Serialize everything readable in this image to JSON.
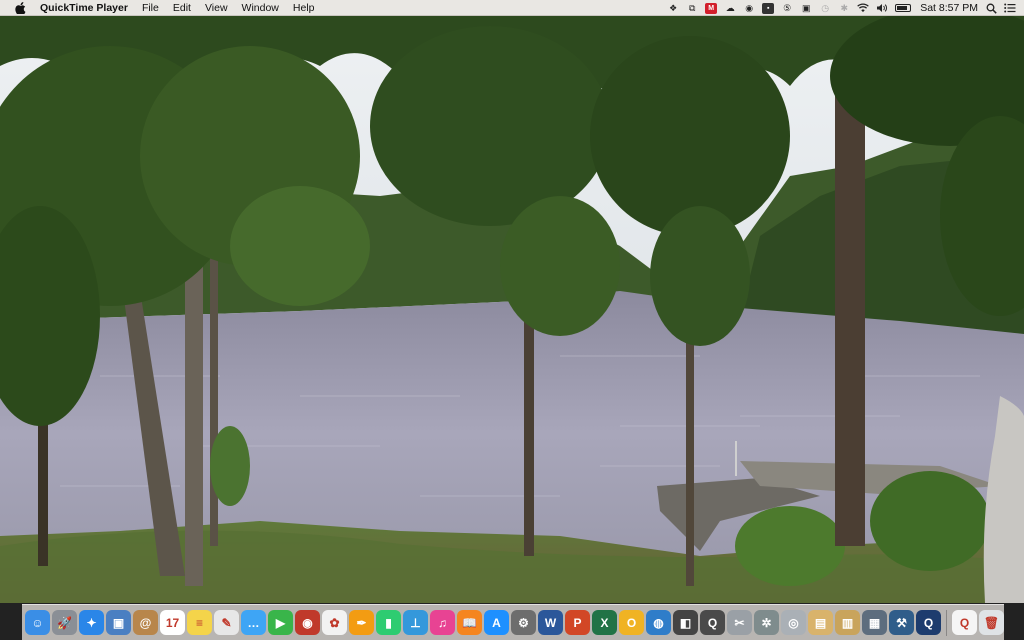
{
  "menubar": {
    "app_name": "QuickTime Player",
    "menus": [
      "File",
      "Edit",
      "View",
      "Window",
      "Help"
    ],
    "clock": "Sat 8:57 PM",
    "battery_level": 0.85,
    "status_icons": [
      "dropbox-icon",
      "copy-icon",
      "mail-m-icon",
      "creative-cloud-icon",
      "eye-icon",
      "terminal-icon",
      "five-icon",
      "camera-icon",
      "time-machine-icon",
      "bluetooth-icon",
      "wifi-icon",
      "volume-icon",
      "battery-icon",
      "spotlight-icon",
      "notification-center-icon"
    ]
  },
  "dock": {
    "apps": [
      {
        "name": "finder-icon",
        "color": "#3a8ee6",
        "glyph": "☺"
      },
      {
        "name": "launchpad-icon",
        "color": "#8a8f96",
        "glyph": "🚀"
      },
      {
        "name": "safari-icon",
        "color": "#2a86e8",
        "glyph": "✦"
      },
      {
        "name": "preview-icon",
        "color": "#4a7fc2",
        "glyph": "▣"
      },
      {
        "name": "contacts-icon",
        "color": "#b8864b",
        "glyph": "@"
      },
      {
        "name": "calendar-icon",
        "color": "#ffffff",
        "glyph": "17"
      },
      {
        "name": "notes-icon",
        "color": "#f4d44a",
        "glyph": "≡"
      },
      {
        "name": "textedit-icon",
        "color": "#e7e7e7",
        "glyph": "✎"
      },
      {
        "name": "messages-icon",
        "color": "#3ea5f5",
        "glyph": "…"
      },
      {
        "name": "facetime-icon",
        "color": "#39b54a",
        "glyph": "▶"
      },
      {
        "name": "photo-booth-icon",
        "color": "#c0392b",
        "glyph": "◉"
      },
      {
        "name": "photos-icon",
        "color": "#f2f2f2",
        "glyph": "✿"
      },
      {
        "name": "pages-icon",
        "color": "#f39c12",
        "glyph": "✒"
      },
      {
        "name": "numbers-icon",
        "color": "#2ecc71",
        "glyph": "▮"
      },
      {
        "name": "keynote-icon",
        "color": "#3498db",
        "glyph": "⊥"
      },
      {
        "name": "itunes-icon",
        "color": "#e84393",
        "glyph": "♫"
      },
      {
        "name": "ibooks-icon",
        "color": "#f5851f",
        "glyph": "📖"
      },
      {
        "name": "app-store-icon",
        "color": "#1e90ff",
        "glyph": "A"
      },
      {
        "name": "system-preferences-icon",
        "color": "#6d6d6d",
        "glyph": "⚙"
      },
      {
        "name": "word-icon",
        "color": "#2b579a",
        "glyph": "W"
      },
      {
        "name": "powerpoint-icon",
        "color": "#d24726",
        "glyph": "P"
      },
      {
        "name": "excel-icon",
        "color": "#217346",
        "glyph": "X"
      },
      {
        "name": "outlook-icon",
        "color": "#f0b323",
        "glyph": "O"
      },
      {
        "name": "globe-icon",
        "color": "#2f7dc9",
        "glyph": "◍"
      },
      {
        "name": "image-capture-icon",
        "color": "#444444",
        "glyph": "◧"
      },
      {
        "name": "quicktime-icon",
        "color": "#4a4a4a",
        "glyph": "Q"
      },
      {
        "name": "script-editor-icon",
        "color": "#9aa0a6",
        "glyph": "✂"
      },
      {
        "name": "digital-color-meter-icon",
        "color": "#7f8c8d",
        "glyph": "✲"
      },
      {
        "name": "screenshot-icon",
        "color": "#aab0b6",
        "glyph": "◎"
      },
      {
        "name": "photo-gallery-icon",
        "color": "#d9b36b",
        "glyph": "▤"
      },
      {
        "name": "image-viewer-icon",
        "color": "#c9a45c",
        "glyph": "▥"
      },
      {
        "name": "disk-utility-icon",
        "color": "#5d6d7e",
        "glyph": "▦"
      },
      {
        "name": "xcode-icon",
        "color": "#2f5d8a",
        "glyph": "⚒"
      },
      {
        "name": "quicktime-player-icon",
        "color": "#1d3c6e",
        "glyph": "Q"
      }
    ],
    "right_items": [
      {
        "name": "document-icon",
        "color": "#f5f5f5",
        "glyph": "Q"
      },
      {
        "name": "trash-icon",
        "color": "#dfe3e6",
        "glyph": "🗑"
      }
    ]
  }
}
